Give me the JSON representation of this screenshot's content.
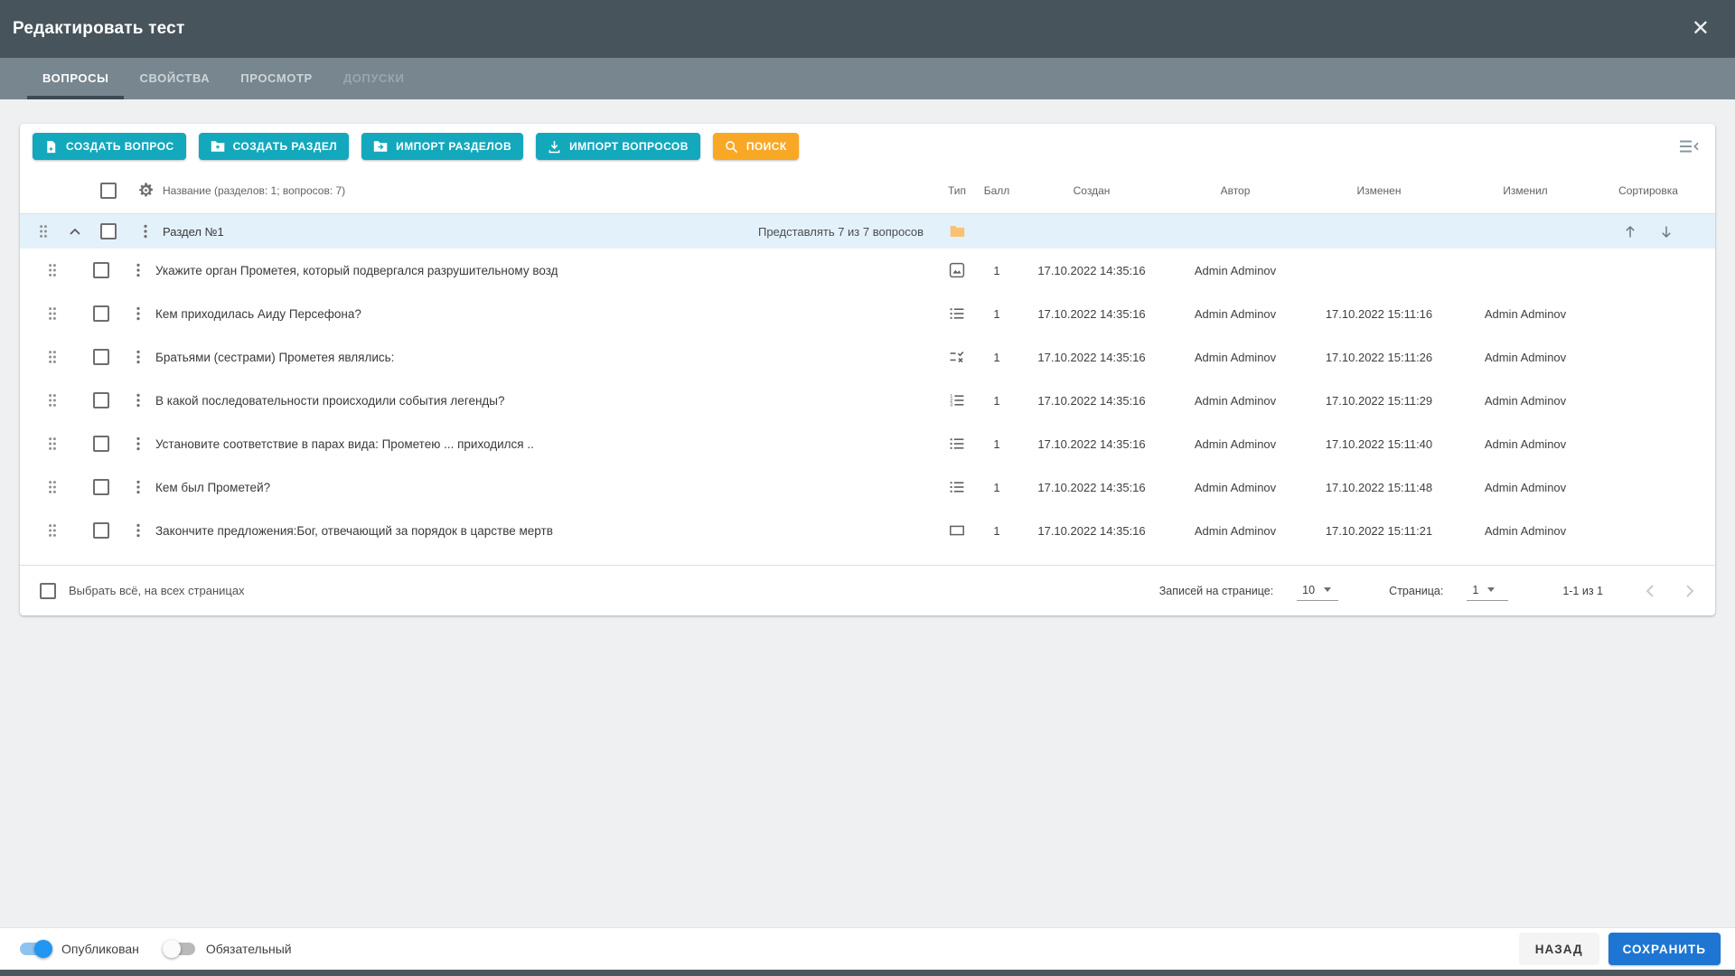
{
  "modal": {
    "title": "Редактировать тест"
  },
  "tabs": [
    {
      "label": "ВОПРОСЫ",
      "state": "active"
    },
    {
      "label": "СВОЙСТВА",
      "state": "normal"
    },
    {
      "label": "ПРОСМОТР",
      "state": "normal"
    },
    {
      "label": "ДОПУСКИ",
      "state": "disabled"
    }
  ],
  "toolbar": {
    "create_question": "СОЗДАТЬ ВОПРОС",
    "create_section": "СОЗДАТЬ РАЗДЕЛ",
    "import_sections": "ИМПОРТ РАЗДЕЛОВ",
    "import_questions": "ИМПОРТ ВОПРОСОВ",
    "search": "ПОИСК",
    "icons": {
      "create_question": "note-add-icon",
      "create_section": "create-folder-icon",
      "import_sections": "folder-import-icon",
      "import_questions": "download-icon",
      "search": "search-icon",
      "right": "menu-collapse-icon"
    }
  },
  "table": {
    "header": {
      "name_label": "Название (разделов: 1; вопросов: 7)",
      "columns": [
        "Тип",
        "Балл",
        "Создан",
        "Автор",
        "Изменен",
        "Изменил",
        "Сортировка"
      ]
    },
    "section": {
      "title": "Раздел №1",
      "info": "Представлять 7 из 7 вопросов",
      "folder_icon": "folder-icon",
      "folder_color": "#f9c272"
    },
    "rows": [
      {
        "text": "Укажите орган Прометея, который подвергался разрушительному возд",
        "type_icon": "image",
        "score": "1",
        "created": "17.10.2022 14:35:16",
        "author": "Admin Adminov",
        "modified": "",
        "modified_by": ""
      },
      {
        "text": "Кем приходилась Аиду Персефона?",
        "type_icon": "list",
        "score": "1",
        "created": "17.10.2022 14:35:16",
        "author": "Admin Adminov",
        "modified": "17.10.2022 15:11:16",
        "modified_by": "Admin Adminov"
      },
      {
        "text": "Братьями (сестрами) Прометея являлись:",
        "type_icon": "truefalse",
        "score": "1",
        "created": "17.10.2022 14:35:16",
        "author": "Admin Adminov",
        "modified": "17.10.2022 15:11:26",
        "modified_by": "Admin Adminov"
      },
      {
        "text": "В какой последовательности происходили события легенды?",
        "type_icon": "ordered",
        "score": "1",
        "created": "17.10.2022 14:35:16",
        "author": "Admin Adminov",
        "modified": "17.10.2022 15:11:29",
        "modified_by": "Admin Adminov"
      },
      {
        "text": "Установите соответствие в парах вида: Прометею ... приходился ..",
        "type_icon": "list",
        "score": "1",
        "created": "17.10.2022 14:35:16",
        "author": "Admin Adminov",
        "modified": "17.10.2022 15:11:40",
        "modified_by": "Admin Adminov"
      },
      {
        "text": "Кем был Прометей?",
        "type_icon": "list",
        "score": "1",
        "created": "17.10.2022 14:35:16",
        "author": "Admin Adminov",
        "modified": "17.10.2022 15:11:48",
        "modified_by": "Admin Adminov"
      },
      {
        "text": "Закончите предложения:Бог, отвечающий за порядок в царстве мертв",
        "type_icon": "rect",
        "score": "1",
        "created": "17.10.2022 14:35:16",
        "author": "Admin Adminov",
        "modified": "17.10.2022 15:11:21",
        "modified_by": "Admin Adminov"
      }
    ],
    "footer": {
      "select_all": "Выбрать всё, на всех страницах",
      "per_page_label": "Записей на странице:",
      "per_page_value": "10",
      "page_label": "Страница:",
      "page_value": "1",
      "range": "1-1 из 1"
    }
  },
  "footer": {
    "published_label": "Опубликован",
    "published_on": true,
    "required_label": "Обязательный",
    "required_on": false,
    "back_label": "НАЗАД",
    "save_label": "СОХРАНИТЬ"
  },
  "colors": {
    "header_bg": "#47545c",
    "tabs_bg": "#78878f",
    "accent_teal": "#14a8bd",
    "accent_orange": "#f9a826",
    "section_row_bg": "#e3f1fb",
    "save_blue": "#1e76d2",
    "toggle_blue": "#2196f3"
  }
}
